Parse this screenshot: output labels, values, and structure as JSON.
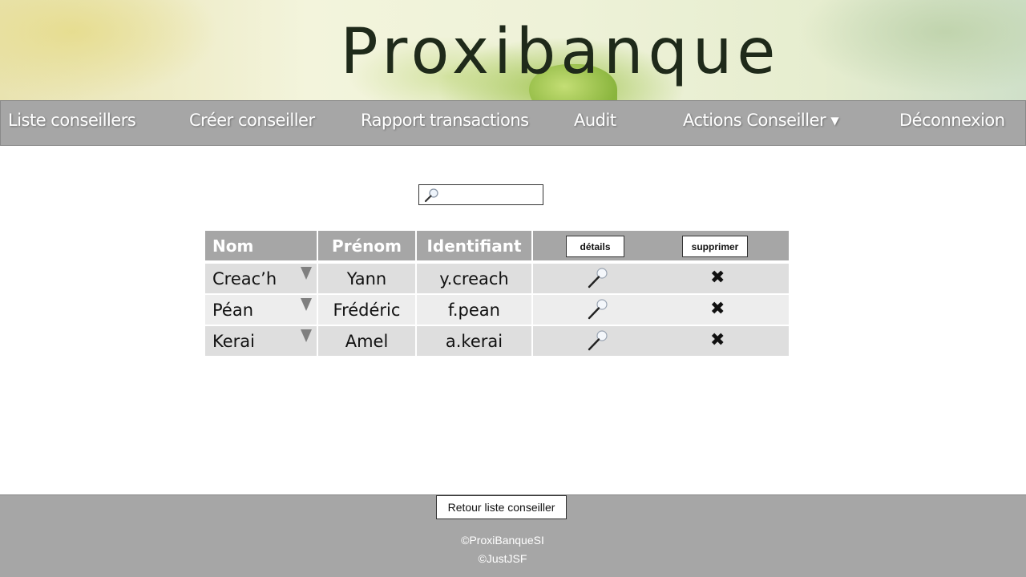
{
  "banner": {
    "logo_text": "Proxibanque"
  },
  "nav": {
    "items": [
      {
        "label": "Liste conseillers"
      },
      {
        "label": "Créer conseiller"
      },
      {
        "label": "Rapport transactions"
      },
      {
        "label": "Audit"
      },
      {
        "label": "Actions Conseiller ▾"
      },
      {
        "label": "Déconnexion"
      }
    ]
  },
  "search": {
    "value": "",
    "icon": "search-icon"
  },
  "table": {
    "columns": {
      "nom": "Nom",
      "prenom": "Prénom",
      "identifiant": "Identifiant"
    },
    "details_button": "détails",
    "delete_button": "supprimer",
    "delete_glyph": "✖",
    "rows": [
      {
        "nom": "Creac’h",
        "prenom": "Yann",
        "identifiant": "y.creach"
      },
      {
        "nom": "Péan",
        "prenom": "Frédéric",
        "identifiant": "f.pean"
      },
      {
        "nom": "Kerai",
        "prenom": "Amel",
        "identifiant": "a.kerai"
      }
    ]
  },
  "footer": {
    "back_button": "Retour liste conseiller",
    "copyright_1": "©ProxiBanqueSI",
    "copyright_2": "©JustJSF"
  },
  "colors": {
    "nav_bg": "#a6a6a6",
    "row_dark": "#dedede",
    "row_light": "#ededed",
    "footer_bg": "#a6a6a6"
  }
}
